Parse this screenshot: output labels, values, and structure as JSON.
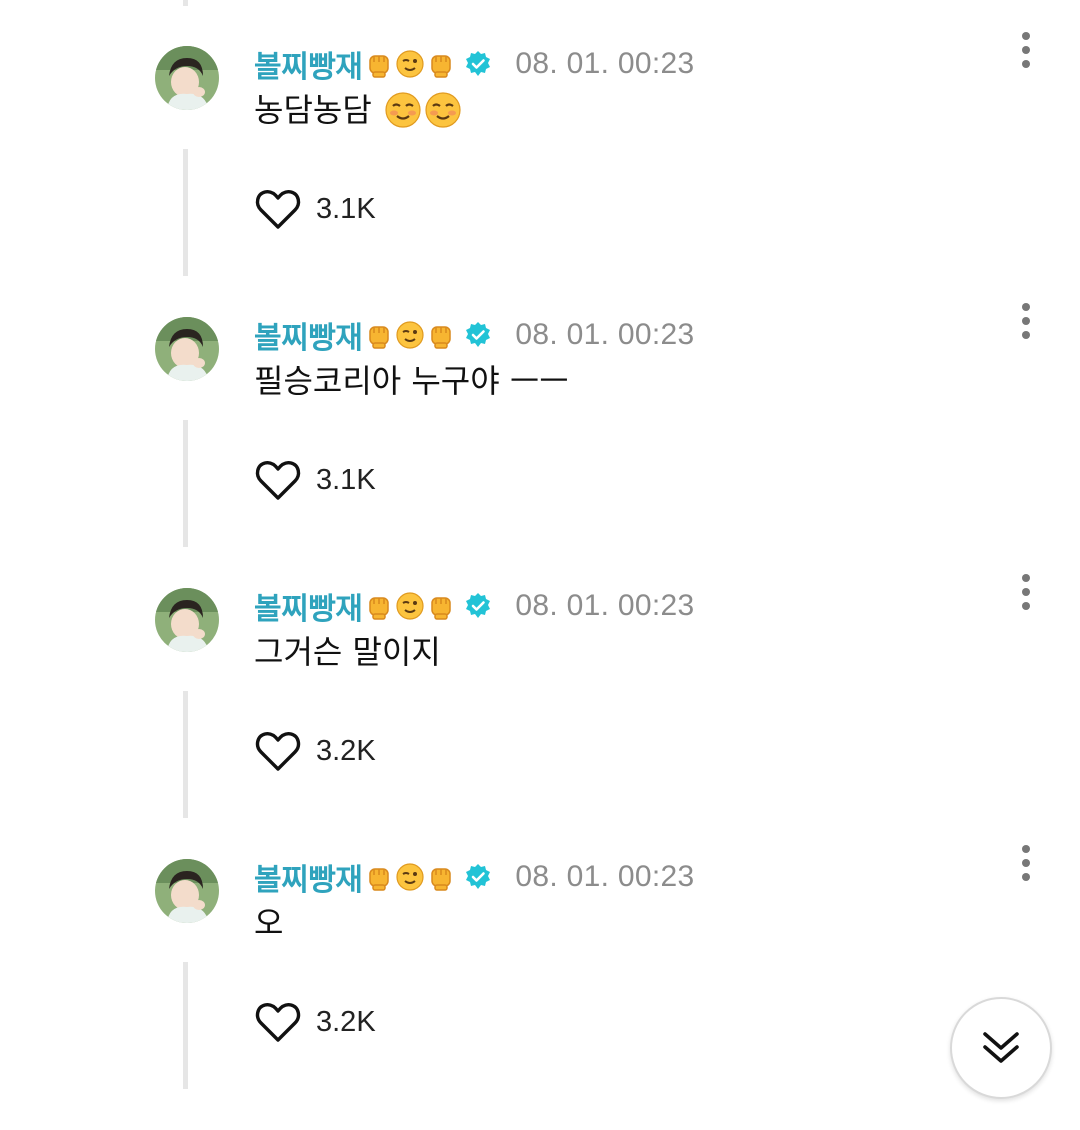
{
  "colors": {
    "author": "#2fa3bd",
    "verified_badge": "#22c3d6",
    "timestamp": "#8c8c8c",
    "thread_line": "#e6e6e6"
  },
  "comments": [
    {
      "author": "볼찌빵재",
      "author_emojis": [
        "raised-fist",
        "winking-face",
        "raised-fist"
      ],
      "verified": true,
      "timestamp": "08. 01. 00:23",
      "text": "농담농담",
      "text_emojis": [
        "smiling-face",
        "smiling-face"
      ],
      "likes": "3.1K"
    },
    {
      "author": "볼찌빵재",
      "author_emojis": [
        "raised-fist",
        "winking-face",
        "raised-fist"
      ],
      "verified": true,
      "timestamp": "08. 01. 00:23",
      "text": "필승코리아 누구야 ㅡㅡ",
      "text_emojis": [],
      "likes": "3.1K"
    },
    {
      "author": "볼찌빵재",
      "author_emojis": [
        "raised-fist",
        "winking-face",
        "raised-fist"
      ],
      "verified": true,
      "timestamp": "08. 01. 00:23",
      "text": "그거슨 말이지",
      "text_emojis": [],
      "likes": "3.2K"
    },
    {
      "author": "볼찌빵재",
      "author_emojis": [
        "raised-fist",
        "winking-face",
        "raised-fist"
      ],
      "verified": true,
      "timestamp": "08. 01. 00:23",
      "text": "오",
      "text_emojis": [],
      "likes": "3.2K"
    }
  ],
  "icons": {
    "like": "heart-outline-icon",
    "more": "more-vertical-icon",
    "verified": "verified-badge-icon",
    "scroll": "double-chevron-down-icon"
  }
}
